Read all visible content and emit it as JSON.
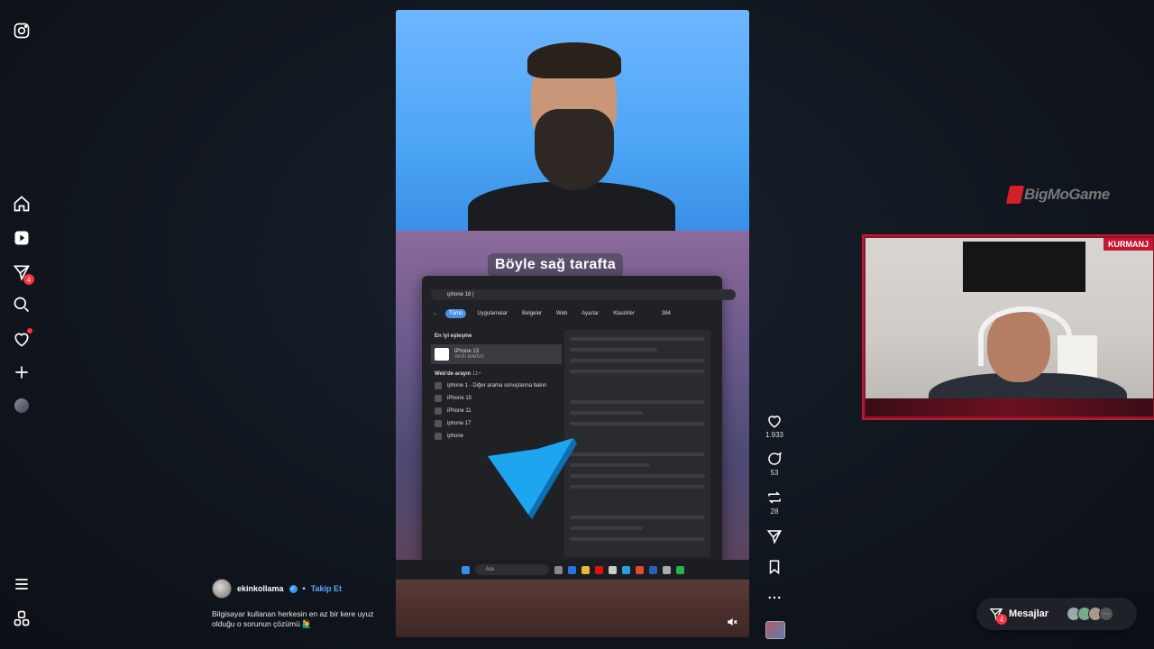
{
  "sidebar": {
    "items": [
      {
        "name": "instagram-logo-icon"
      },
      {
        "name": "home-icon"
      },
      {
        "name": "reels-icon"
      },
      {
        "name": "messages-icon",
        "badge": "4"
      },
      {
        "name": "search-icon"
      },
      {
        "name": "notifications-icon"
      },
      {
        "name": "create-icon"
      },
      {
        "name": "profile-avatar"
      },
      {
        "name": "menu-icon"
      },
      {
        "name": "also-from-meta-icon"
      }
    ]
  },
  "reel": {
    "caption": "Böyle sağ tarafta",
    "window": {
      "search_text": "iphone 18 |",
      "tabs": [
        "Tümü",
        "Uygulamalar",
        "Belgeler",
        "Web",
        "Ayarlar",
        "Klasörler"
      ],
      "tab_extra": "384",
      "best_match_header": "En iyi eşleşme",
      "best_match_title": "iPhone 13",
      "best_match_sub": "Akıllı telefon",
      "web_header": "Web'de arayın",
      "web_header_count": "11+",
      "results": [
        "iphone 1 - Diğer arama sonuçlarına bakın",
        "iPhone 15",
        "iPhone 11",
        "iphone 17",
        "iphone"
      ]
    },
    "taskbar_search": "Ara"
  },
  "actions": {
    "likes": "1.933",
    "comments": "53",
    "reposts": "28"
  },
  "account": {
    "username": "ekinkollama",
    "follow_label": "Takip Et",
    "description": "Bilgisayar kullanan herkesin en az bir kere uyuz olduğu o sorunun çözümü 🙋‍♂️"
  },
  "overlay": {
    "brand": "BigMoGame",
    "cam_tag": "KURMANJ"
  },
  "messages": {
    "label": "Mesajlar",
    "badge": "4"
  },
  "colors": {
    "accent_blue": "#3897f0",
    "badge_red": "#ff3040",
    "cam_border": "#c21832"
  }
}
